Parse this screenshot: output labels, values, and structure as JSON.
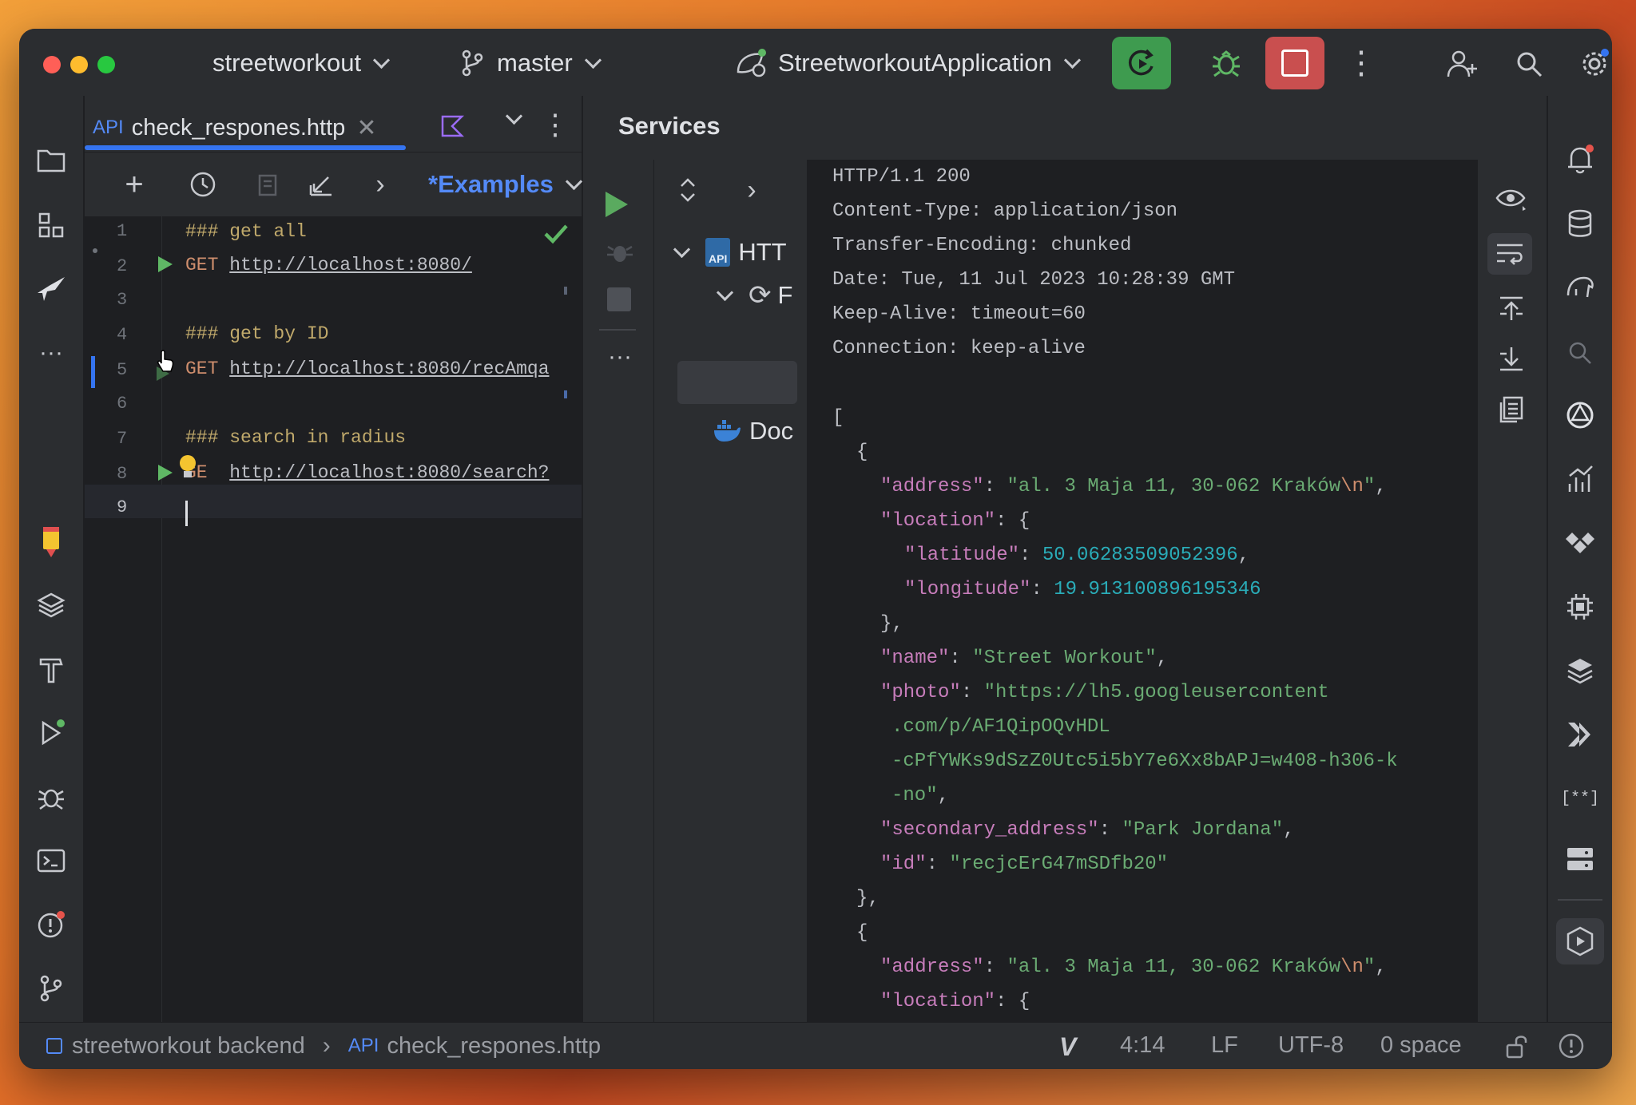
{
  "titlebar": {
    "project": "streetworkout",
    "branch": "master",
    "run_config": "StreetworkoutApplication"
  },
  "editor": {
    "tab_label": "check_respones.http",
    "tab_prefix": "API",
    "examples_label": "*Examples",
    "lines": [
      {
        "n": "1",
        "text": "### get all"
      },
      {
        "n": "2",
        "method": "GET",
        "url": "http://localhost:8080/"
      },
      {
        "n": "3",
        "text": ""
      },
      {
        "n": "4",
        "text": "### get by ID"
      },
      {
        "n": "5",
        "method": "GET",
        "url": "http://localhost:8080/recAmqa"
      },
      {
        "n": "6",
        "text": ""
      },
      {
        "n": "7",
        "text": "### search in radius"
      },
      {
        "n": "8",
        "method": "GE",
        "url": "http://localhost:8080/search?"
      },
      {
        "n": "9",
        "text": ""
      }
    ]
  },
  "services": {
    "title": "Services",
    "tree": {
      "http_node": "HTT",
      "child_node": "F",
      "docker_node": "Doc"
    },
    "response": {
      "headers": [
        "HTTP/1.1 200",
        "Content-Type: application/json",
        "Transfer-Encoding: chunked",
        "Date: Tue, 11 Jul 2023 10:28:39 GMT",
        "Keep-Alive: timeout=60",
        "Connection: keep-alive"
      ],
      "open_bracket": "[",
      "open_brace": "{",
      "address_key": "\"address\"",
      "address_value": "\"al. 3 Maja 11, 30-062 Kraków",
      "address_escape": "\\n",
      "location_key": "\"location\"",
      "latitude_key": "\"latitude\"",
      "latitude_value": "50.06283509052396",
      "longitude_key": "\"longitude\"",
      "longitude_value": "19.913100896195346",
      "close_inner": "},",
      "name_key": "\"name\"",
      "name_value": "\"Street Workout\"",
      "photo_key": "\"photo\"",
      "photo_value_1": "\"https://lh5.googleusercontent",
      "photo_value_2": ".com/p/AF1QipOQvHDL",
      "photo_value_3": "-cPfYWKs9dSzZ0Utc5i5bY7e6Xx8bAPJ=w408-h306-k",
      "photo_value_4": "-no\"",
      "secondary_key": "\"secondary_address\"",
      "secondary_value": "\"Park Jordana\"",
      "id_key": "\"id\"",
      "id_value": "\"recjcErG47mSDfb20\"",
      "close_outer": "},",
      "open_brace2": "{",
      "address_key2": "\"address\"",
      "address_value2": "\"al. 3 Maja 11, 30-062 Kraków",
      "address_escape2": "\\n",
      "location_key2": "\"location\"",
      "open_loc2": "{"
    }
  },
  "statusbar": {
    "project": "streetworkout backend",
    "file_prefix": "API",
    "file": "check_respones.http",
    "position": "4:14",
    "line_sep": "LF",
    "encoding": "UTF-8",
    "indent": "0 space"
  },
  "colors": {
    "accent": "#3574f0",
    "run_button": "#3e9b4f",
    "stop_button": "#c94f4f"
  }
}
